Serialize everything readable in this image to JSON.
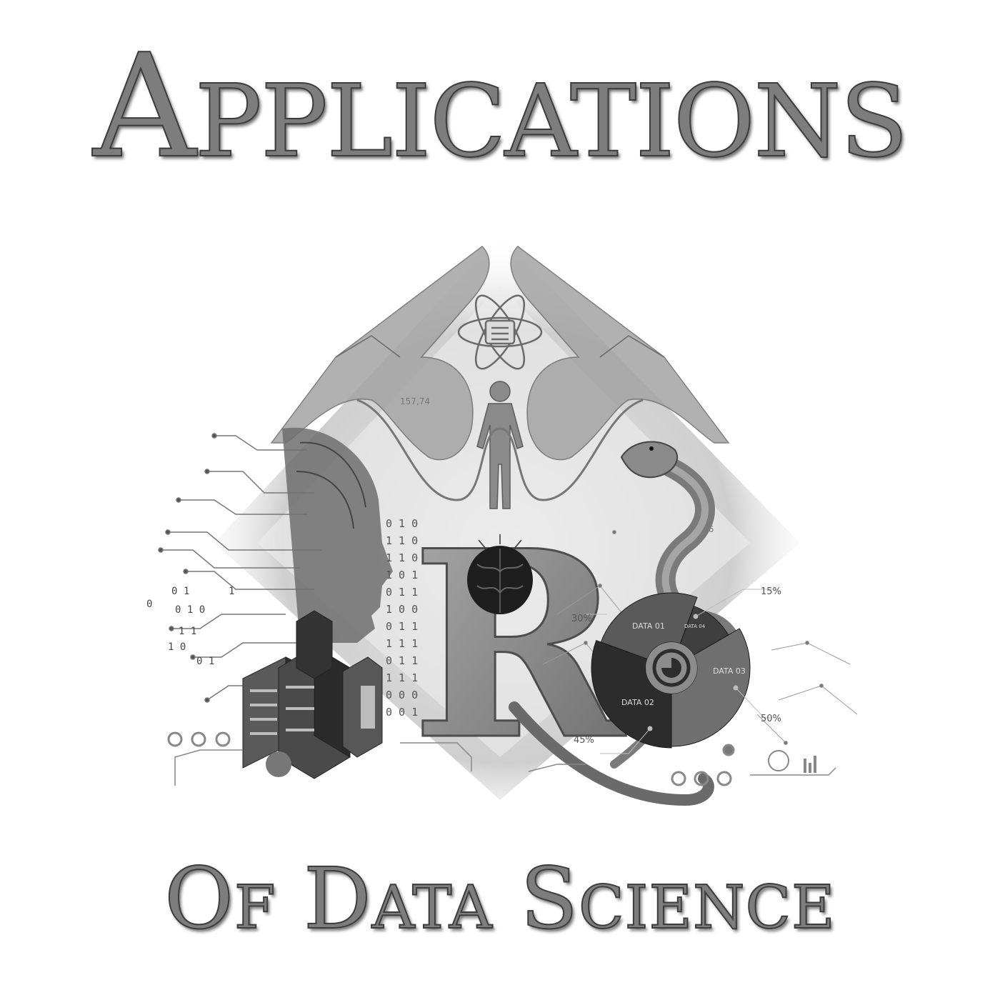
{
  "title": {
    "line1": "Applications",
    "line2": "Of Data Science"
  },
  "art": {
    "center_letter": "R",
    "readouts": {
      "top_left": "157,74",
      "right": "98,76"
    },
    "donut": {
      "segments": [
        {
          "label": "DATA 01",
          "color": "#5a5a5a"
        },
        {
          "label": "DATA 02",
          "color": "#2c2c2c"
        },
        {
          "label": "DATA 03",
          "color": "#6f6f6f"
        },
        {
          "label": "DATA 04",
          "color": "#3f3f3f"
        }
      ]
    },
    "percents": {
      "p15": "15%",
      "p30": "30%",
      "p50": "50%",
      "p45": "45%"
    },
    "binary_rows": [
      "0 1 0",
      "1 1 0",
      "1 1 0",
      "1 0 1",
      "0 1 1",
      "1 0 0",
      "0 1 1",
      "1 1 1",
      "0 1 1",
      "1 1 1",
      "0 0 0",
      "0 0 1"
    ],
    "binary_left": [
      "0 1",
      "1",
      "0 1 0",
      "1 1",
      "0 1",
      "0",
      "1 0"
    ],
    "icons": [
      "atom-icon",
      "person-figure-icon",
      "brain-icon",
      "snake-icon",
      "server-building-icon",
      "ai-head-icon",
      "hands-icon"
    ],
    "palette": {
      "title_fill": "#7d7d7d",
      "title_stroke": "#3d3d3d",
      "hands": "#9d9d9d",
      "backdrop": "#d4d4d4"
    }
  }
}
